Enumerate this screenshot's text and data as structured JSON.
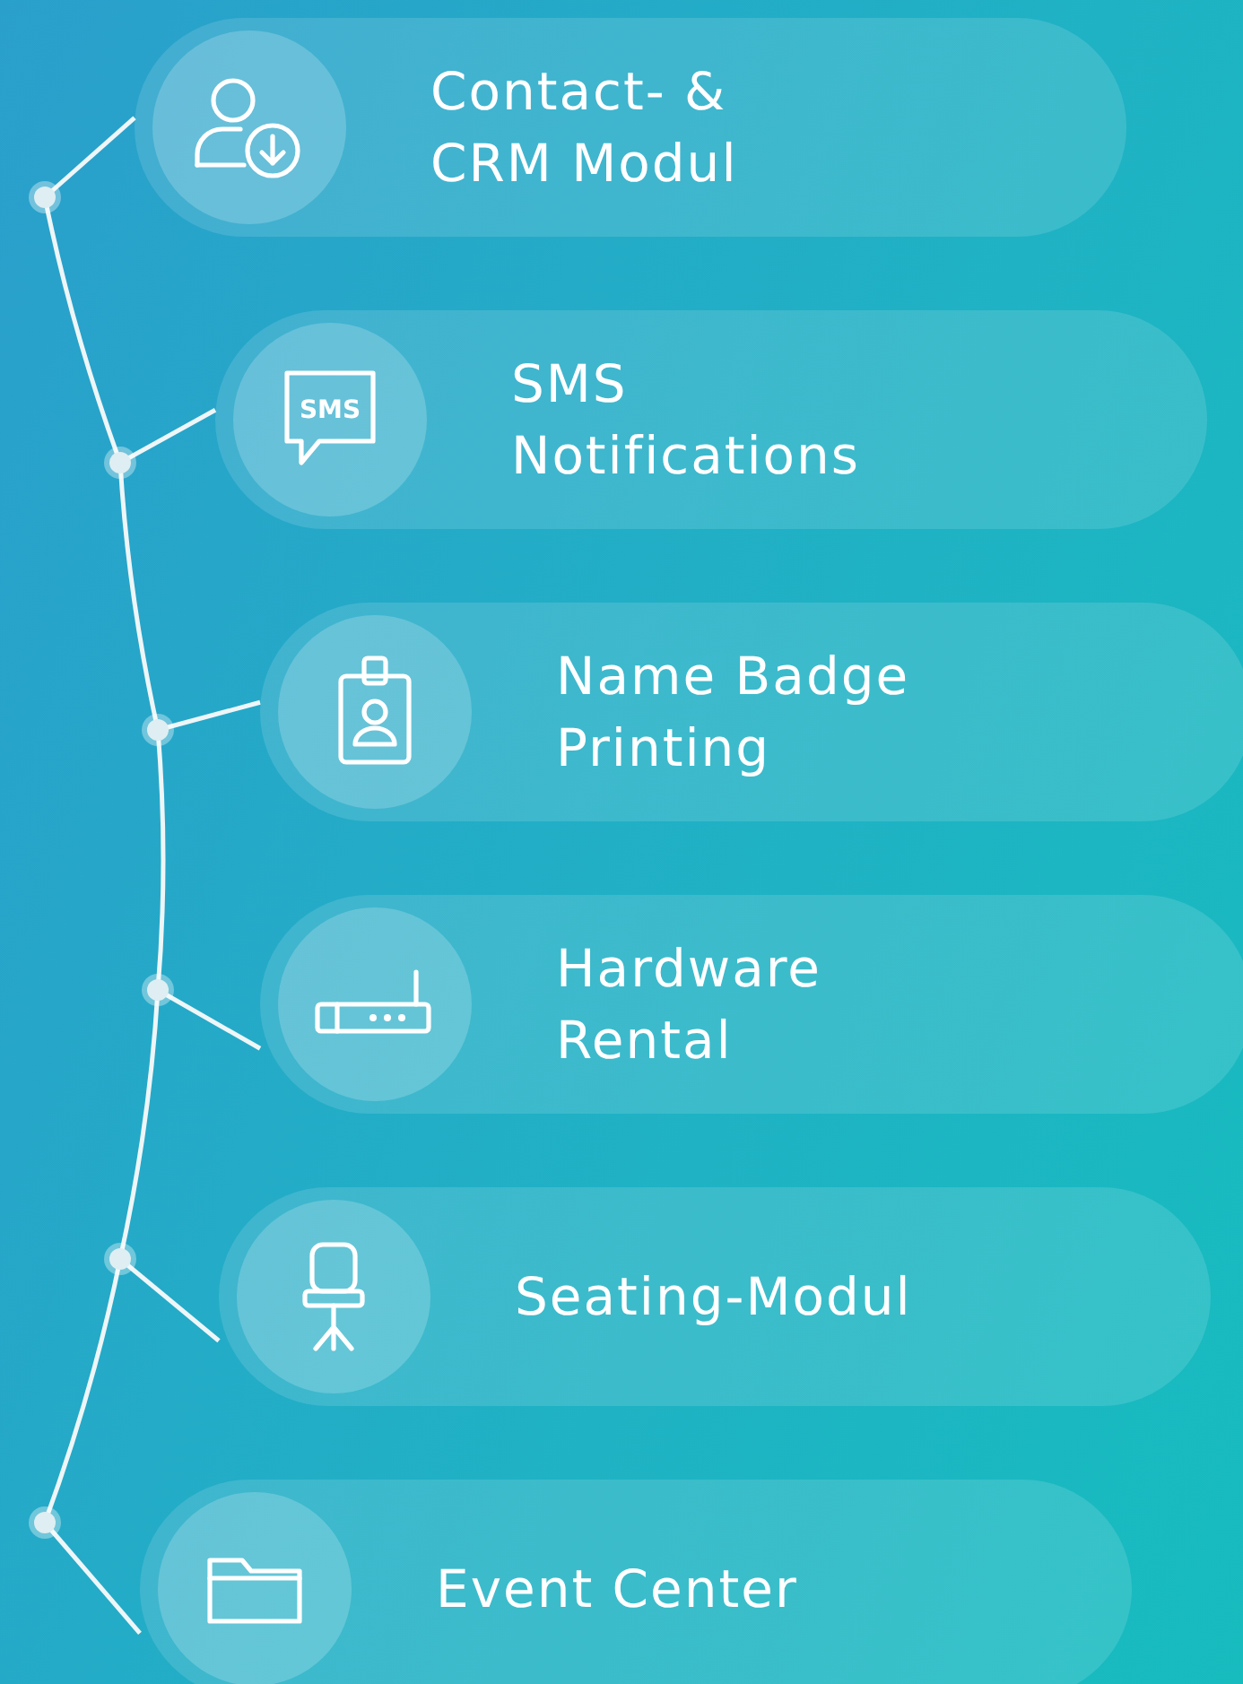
{
  "modules": [
    {
      "kind": "contact",
      "lines": [
        "Contact- &",
        "CRM Modul"
      ]
    },
    {
      "kind": "sms",
      "icon_text": "SMS",
      "lines": [
        "SMS",
        "Notifications"
      ]
    },
    {
      "kind": "badge",
      "lines": [
        "Name Badge",
        "Printing"
      ]
    },
    {
      "kind": "hardware",
      "lines": [
        "Hardware",
        "Rental"
      ]
    },
    {
      "kind": "seating",
      "lines": [
        "Seating-Modul"
      ]
    },
    {
      "kind": "folder",
      "lines": [
        "Event Center"
      ]
    }
  ]
}
